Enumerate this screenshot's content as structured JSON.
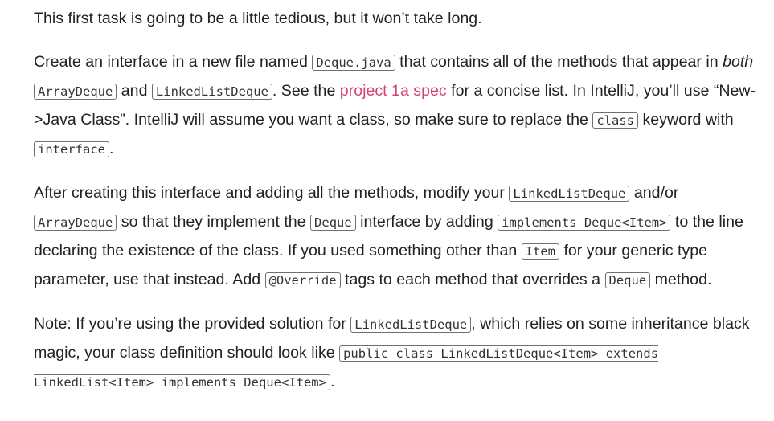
{
  "p1": {
    "text": "This first task is going to be a little tedious, but it won’t take long."
  },
  "p2": {
    "t1": "Create an interface in a new file named ",
    "c1": "Deque.java",
    "t2": " that contains all of the methods that appear in ",
    "em1": "both",
    "t3": " ",
    "c2": "ArrayDeque",
    "t4": " and ",
    "c3": "LinkedListDeque",
    "t5": ". See the ",
    "link": "project 1a spec",
    "t6": " for a concise list. In IntelliJ, you’ll use “New->Java Class”. IntelliJ will assume you want a class, so make sure to replace the ",
    "c4": "class",
    "t7": " keyword with ",
    "c5": "interface",
    "t8": "."
  },
  "p3": {
    "t1": "After creating this interface and adding all the methods, modify your ",
    "c1": "LinkedListDeque",
    "t2": " and/or ",
    "c2": "ArrayDeque",
    "t3": " so that they implement the ",
    "c3": "Deque",
    "t4": " interface by adding ",
    "c4": "implements Deque<Item>",
    "t5": " to the line declaring the existence of the class. If you used something other than ",
    "c5": "Item",
    "t6": " for your generic type parameter, use that instead. Add ",
    "c6": "@Override",
    "t7": " tags to each method that overrides a ",
    "c7": "Deque",
    "t8": " method."
  },
  "p4": {
    "t1": "Note: If you’re using the provided solution for ",
    "c1": "LinkedListDeque",
    "t2": ", which relies on some inheritance black magic, your class definition should look like ",
    "c2": "public class LinkedListDeque<Item> extends LinkedList<Item> implements Deque<Item>",
    "t3": "."
  }
}
